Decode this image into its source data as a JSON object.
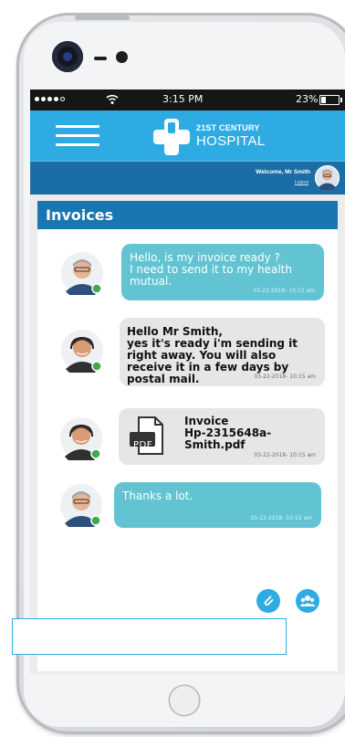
{
  "status_bar": {
    "time": "3:15 PM",
    "battery": "23%"
  },
  "header": {
    "logo_line1": "21ST CENTURY",
    "logo_line2": "HOSPITAL"
  },
  "welcome": {
    "text": "Welcome, Mr Smith",
    "logout": "Logout"
  },
  "page": {
    "title": "Invoices"
  },
  "messages": [
    {
      "text": "Hello, is my invoice ready ?\nI need to send it to my health mutual.",
      "time": "03-22-2018- 10:15 am"
    },
    {
      "text": "Hello Mr Smith,\nyes it's ready i'm sending it right away. You will also receive it in a few days by postal mail.",
      "time": "03-22-2018- 10:15 am"
    },
    {
      "file_icon_label": "PDF",
      "file_title": "Invoice\nHp-2315648a-Smith.pdf",
      "time": "03-22-2018- 10:15 am"
    },
    {
      "text": "Thanks a lot.",
      "time": "03-22-2018- 10:15 am"
    }
  ],
  "composer": {
    "value": "",
    "placeholder": ""
  },
  "colors": {
    "primary": "#2eabe2",
    "dark_blue": "#1a76b1",
    "teal_bubble": "#62c4d2",
    "gray_bubble": "#e6e6e6",
    "online": "#3cab4b"
  },
  "icons": [
    "hamburger-menu-icon",
    "wifi-icon",
    "battery-icon",
    "hospital-cross-logo",
    "pdf-file-icon",
    "attach-icon",
    "group-icon"
  ]
}
